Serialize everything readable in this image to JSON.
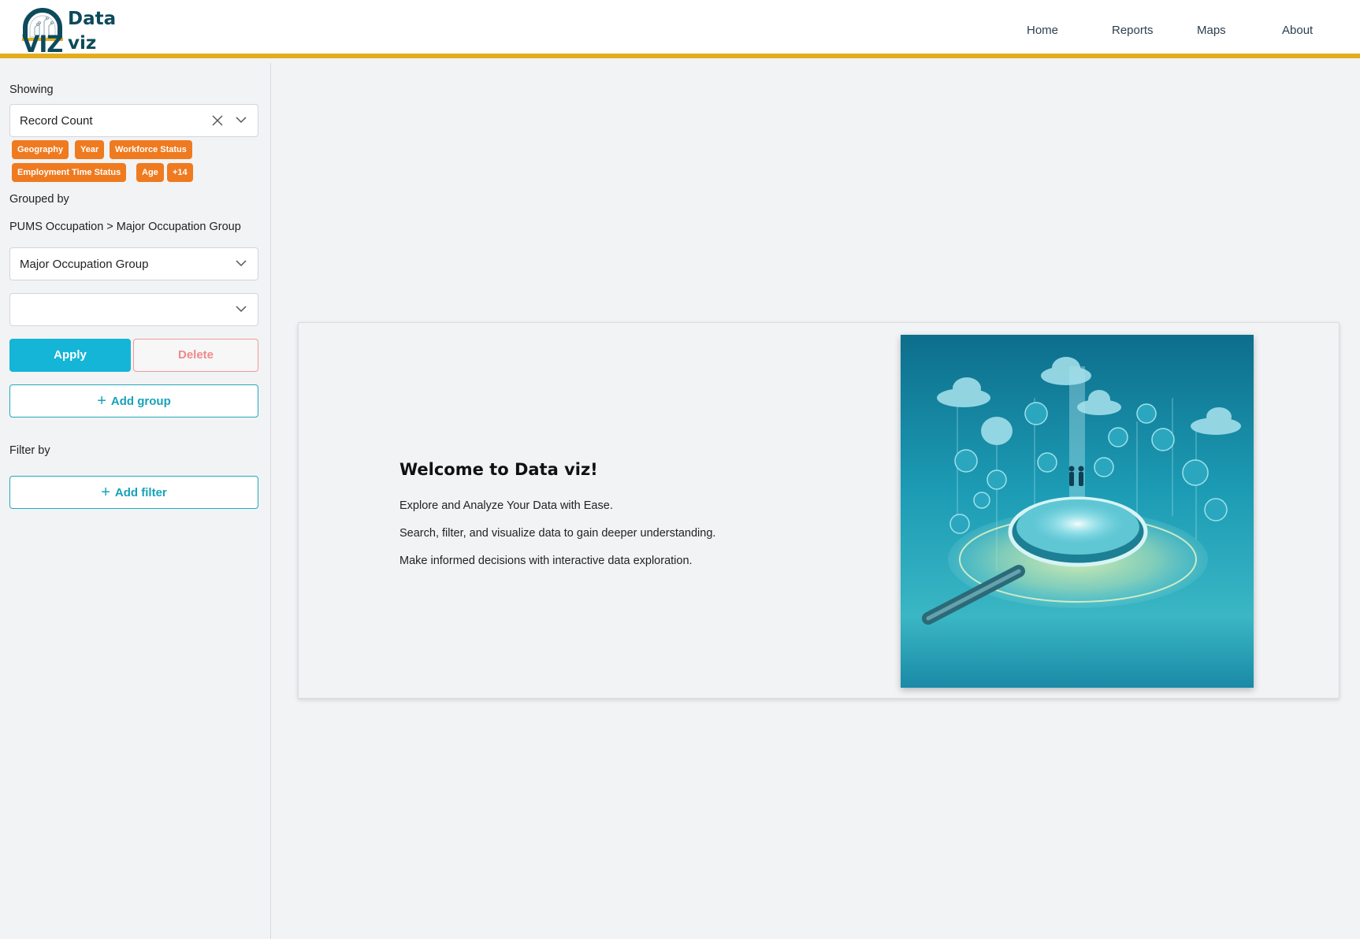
{
  "brand": {
    "word1": "Data",
    "word2": "viz",
    "mark": "VIZ"
  },
  "nav": [
    "Home",
    "Reports",
    "Maps",
    "About"
  ],
  "sidebar": {
    "showing_label": "Showing",
    "measure_value": "Record Count",
    "chips": [
      "Geography",
      "Year",
      "Workforce Status",
      "Employment Time Status",
      "Age",
      "+14"
    ],
    "grouped_label": "Grouped by",
    "breadcrumb": "PUMS Occupation > Major Occupation Group",
    "group_select_value": "Major Occupation Group",
    "group_select2_value": "",
    "apply_label": "Apply",
    "delete_label": "Delete",
    "add_group_label": "Add group",
    "filter_label": "Filter by",
    "add_filter_label": "Add filter"
  },
  "welcome": {
    "title": "Welcome to Data viz!",
    "lines": [
      "Explore and Analyze Your Data with Ease.",
      "Search, filter, and visualize data to gain deeper understanding.",
      "Make informed decisions with interactive data exploration."
    ]
  },
  "colors": {
    "accent_bar": "#e3ad1c",
    "chip": "#ef7a1f",
    "apply": "#14b5d6",
    "outline": "#22a9bd",
    "brand_text": "#0c4a5c"
  }
}
